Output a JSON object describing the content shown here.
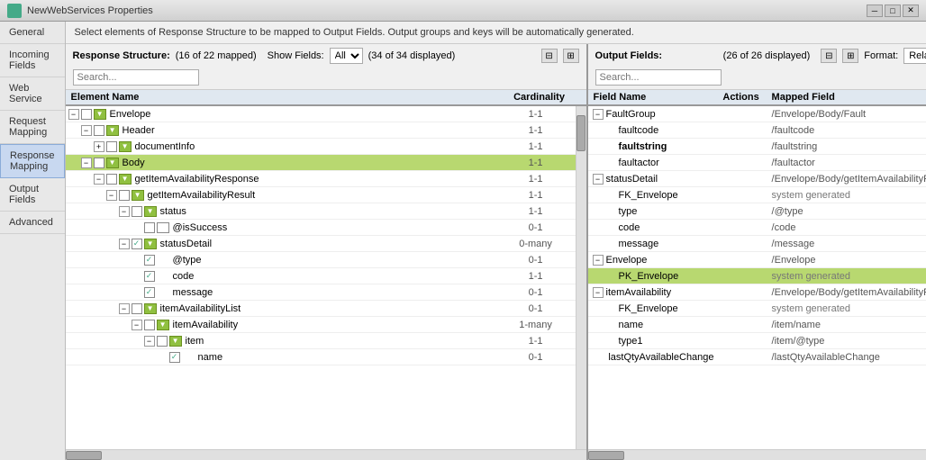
{
  "titleBar": {
    "icon": "web-services-icon",
    "title": "NewWebServices Properties",
    "controls": [
      "minimize",
      "restore",
      "close"
    ]
  },
  "sidebar": {
    "items": [
      {
        "id": "general",
        "label": "General"
      },
      {
        "id": "incoming-fields",
        "label": "Incoming Fields"
      },
      {
        "id": "web-service",
        "label": "Web Service"
      },
      {
        "id": "request-mapping",
        "label": "Request Mapping"
      },
      {
        "id": "response-mapping",
        "label": "Response Mapping",
        "active": true
      },
      {
        "id": "output-fields",
        "label": "Output Fields"
      },
      {
        "id": "advanced",
        "label": "Advanced"
      }
    ]
  },
  "description": "Select elements of Response Structure to be mapped to Output Fields. Output groups and keys will be automatically generated.",
  "leftPanel": {
    "title": "Response Structure:",
    "mappedInfo": "(16 of 22 mapped)",
    "showFieldsLabel": "Show Fields:",
    "showFieldsValue": "All",
    "displayedInfo": "(34 of 34 displayed)",
    "searchPlaceholder": "Search...",
    "columns": {
      "elementName": "Element Name",
      "cardinality": "Cardinality"
    },
    "treeRows": [
      {
        "indent": 0,
        "expand": "minus",
        "checkbox": false,
        "typeIcon": "green",
        "hasArrow": true,
        "label": "Envelope",
        "cardinality": "1-1"
      },
      {
        "indent": 1,
        "expand": "minus",
        "checkbox": false,
        "typeIcon": "green",
        "hasArrow": true,
        "label": "Header",
        "cardinality": "1-1"
      },
      {
        "indent": 2,
        "expand": "plus",
        "checkbox": false,
        "typeIcon": "green",
        "hasArrow": true,
        "label": "documentInfo",
        "cardinality": "1-1"
      },
      {
        "indent": 1,
        "expand": "minus",
        "checkbox": false,
        "typeIcon": "green",
        "hasArrow": true,
        "label": "Body",
        "cardinality": "1-1",
        "selected": true
      },
      {
        "indent": 2,
        "expand": "minus",
        "checkbox": false,
        "typeIcon": "green",
        "hasArrow": true,
        "label": "getItemAvailabilityResponse",
        "cardinality": "1-1"
      },
      {
        "indent": 3,
        "expand": "minus",
        "checkbox": false,
        "typeIcon": "green",
        "hasArrow": true,
        "label": "getItemAvailabilityResult",
        "cardinality": "1-1"
      },
      {
        "indent": 4,
        "expand": "minus",
        "checkbox": false,
        "typeIcon": "green",
        "hasArrow": true,
        "label": "status",
        "cardinality": "1-1"
      },
      {
        "indent": 5,
        "expand": null,
        "checkbox": false,
        "typeIcon": "empty",
        "hasArrow": false,
        "label": "@isSuccess",
        "cardinality": "0-1"
      },
      {
        "indent": 4,
        "expand": "minus",
        "checkbox": true,
        "typeIcon": "green",
        "hasArrow": true,
        "label": "statusDetail",
        "cardinality": "0-many"
      },
      {
        "indent": 5,
        "expand": null,
        "checkbox": true,
        "typeIcon": null,
        "hasArrow": false,
        "label": "@type",
        "cardinality": "0-1"
      },
      {
        "indent": 5,
        "expand": null,
        "checkbox": true,
        "typeIcon": null,
        "hasArrow": false,
        "label": "code",
        "cardinality": "1-1"
      },
      {
        "indent": 5,
        "expand": null,
        "checkbox": true,
        "typeIcon": null,
        "hasArrow": false,
        "label": "message",
        "cardinality": "0-1"
      },
      {
        "indent": 4,
        "expand": "minus",
        "checkbox": false,
        "typeIcon": "green",
        "hasArrow": true,
        "label": "itemAvailabilityList",
        "cardinality": "0-1"
      },
      {
        "indent": 5,
        "expand": "minus",
        "checkbox": false,
        "typeIcon": "green",
        "hasArrow": true,
        "label": "itemAvailability",
        "cardinality": "1-many"
      },
      {
        "indent": 6,
        "expand": "minus",
        "checkbox": false,
        "typeIcon": "green",
        "hasArrow": true,
        "label": "item",
        "cardinality": "1-1"
      },
      {
        "indent": 7,
        "expand": null,
        "checkbox": true,
        "typeIcon": null,
        "hasArrow": false,
        "label": "name",
        "cardinality": "0-1"
      }
    ]
  },
  "rightPanel": {
    "title": "Output Fields:",
    "displayedInfo": "(26 of 26 displayed)",
    "formatLabel": "Format:",
    "formatValue": "Relational",
    "searchPlaceholder": "Search...",
    "columns": {
      "fieldName": "Field Name",
      "actions": "Actions",
      "mappedField": "Mapped Field"
    },
    "treeRows": [
      {
        "indent": 0,
        "expand": "minus",
        "label": "FaultGroup",
        "mappedField": "/Envelope/Body/Fault"
      },
      {
        "indent": 1,
        "expand": null,
        "label": "faultcode",
        "mappedField": "/faultcode"
      },
      {
        "indent": 1,
        "expand": null,
        "label": "faultstring",
        "mappedField": "/faultstring",
        "bold": true
      },
      {
        "indent": 1,
        "expand": null,
        "label": "faultactor",
        "mappedField": "/faultactor"
      },
      {
        "indent": 0,
        "expand": "minus",
        "label": "statusDetail",
        "mappedField": "/Envelope/Body/getItemAvailabilityRespon..."
      },
      {
        "indent": 1,
        "expand": null,
        "label": "FK_Envelope",
        "mappedField": "system generated"
      },
      {
        "indent": 1,
        "expand": null,
        "label": "type",
        "mappedField": "/@type"
      },
      {
        "indent": 1,
        "expand": null,
        "label": "code",
        "mappedField": "/code"
      },
      {
        "indent": 1,
        "expand": null,
        "label": "message",
        "mappedField": "/message"
      },
      {
        "indent": 0,
        "expand": "minus",
        "label": "Envelope",
        "mappedField": "/Envelope"
      },
      {
        "indent": 1,
        "expand": null,
        "label": "PK_Envelope",
        "mappedField": "system generated",
        "selected": true
      },
      {
        "indent": 0,
        "expand": "minus",
        "label": "itemAvailability",
        "mappedField": "/Envelope/Body/getItemAvailabilityRespon..."
      },
      {
        "indent": 1,
        "expand": null,
        "label": "FK_Envelope",
        "mappedField": "system generated"
      },
      {
        "indent": 1,
        "expand": null,
        "label": "name",
        "mappedField": "/item/name"
      },
      {
        "indent": 1,
        "expand": null,
        "label": "type1",
        "mappedField": "/item/@type"
      },
      {
        "indent": 1,
        "expand": null,
        "label": "lastQtyAvailableChange",
        "mappedField": "/lastQtyAvailableChange"
      }
    ]
  }
}
